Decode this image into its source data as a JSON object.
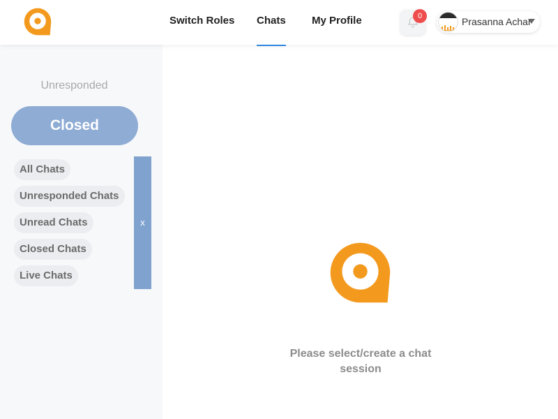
{
  "brand": {
    "accent": "#f39a1e"
  },
  "header": {
    "nav": [
      {
        "label": "Switch Roles",
        "active": false
      },
      {
        "label": "Chats",
        "active": true
      },
      {
        "label": "My Profile",
        "active": false
      }
    ],
    "notifications": {
      "count": "0",
      "icon": "bell-icon"
    },
    "user": {
      "name": "Prasanna Achar",
      "icon": "chevron-down-icon"
    }
  },
  "sidebar": {
    "section_label": "Unresponded",
    "primary_button": "Closed",
    "filters": [
      "All Chats",
      "Unresponded Chats",
      "Unread Chats",
      "Closed Chats",
      "Live Chats"
    ],
    "close_label": "x"
  },
  "main": {
    "empty_state": "Please select/create a chat session"
  }
}
